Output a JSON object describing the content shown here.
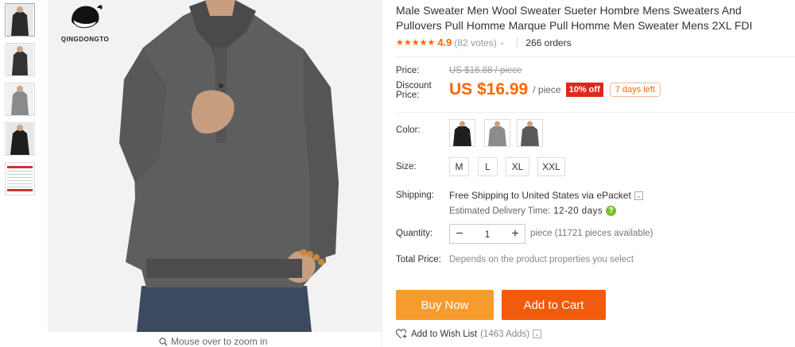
{
  "gallery": {
    "thumbnails": [
      "black-sweater",
      "black-sweater-side",
      "gray-sweater",
      "dark-sweater",
      "size-chart"
    ],
    "brand": "QINGDONGTO",
    "zoom_hint": "Mouse over to zoom in"
  },
  "product": {
    "title": "Male Sweater Men Wool Sweater Sueter Hombre Mens Sweaters And Pullovers Pull Homme Marque Pull Homme Men Sweater Mens 2XL FDI",
    "rating": {
      "stars": "★★★★★",
      "value": "4.9",
      "votes": "(82 votes)",
      "orders": "266 orders"
    }
  },
  "price": {
    "price_label": "Price:",
    "original": "US $18.88 / piece",
    "discount_label_1": "Discount",
    "discount_label_2": "Price:",
    "current": "US $16.99",
    "per_piece": "/ piece",
    "off_badge": "10% off",
    "days_left": "7 days left",
    "accent_color": "#ff6600"
  },
  "options": {
    "color_label": "Color:",
    "size_label": "Size:",
    "sizes": [
      "M",
      "L",
      "XL",
      "XXL"
    ]
  },
  "shipping": {
    "label": "Shipping:",
    "text": "Free Shipping to United States via ePacket",
    "delivery_label": "Estimated Delivery Time:",
    "delivery_days": "12-20 days"
  },
  "quantity": {
    "label": "Quantity:",
    "value": "1",
    "note": "piece (11721 pieces available)"
  },
  "total": {
    "label": "Total Price:",
    "note": "Depends on the product properties you select"
  },
  "actions": {
    "buy_now": "Buy Now",
    "add_to_cart": "Add to Cart",
    "wish_list": "Add to Wish List",
    "wish_count": "(1463 Adds)"
  }
}
